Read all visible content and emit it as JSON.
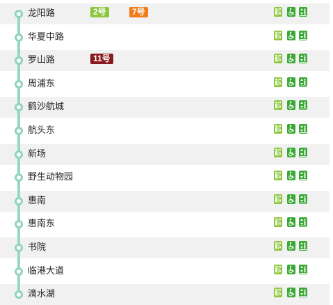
{
  "colors": {
    "route_line": "#94d7c4",
    "line_2": "#8cc63f",
    "line_7": "#ef7d1a",
    "line_11": "#8b1a1f",
    "facility_toilet": "#8cc63f",
    "facility_accessible": "#3aa935",
    "facility_elevator": "#3aa935"
  },
  "icons": [
    "toilet-icon",
    "accessibility-icon",
    "elevator-icon"
  ],
  "stations": [
    {
      "name": "龙阳路",
      "transfers": [
        {
          "label": "2号",
          "color": "#8cc63f"
        },
        {
          "label": "7号",
          "color": "#ef7d1a"
        }
      ]
    },
    {
      "name": "华夏中路",
      "transfers": []
    },
    {
      "name": "罗山路",
      "transfers": [
        {
          "label": "11号",
          "color": "#8b1a1f"
        }
      ]
    },
    {
      "name": "周浦东",
      "transfers": []
    },
    {
      "name": "鹤沙航城",
      "transfers": []
    },
    {
      "name": "航头东",
      "transfers": []
    },
    {
      "name": "新场",
      "transfers": []
    },
    {
      "name": "野生动物园",
      "transfers": []
    },
    {
      "name": "惠南",
      "transfers": []
    },
    {
      "name": "惠南东",
      "transfers": []
    },
    {
      "name": "书院",
      "transfers": []
    },
    {
      "name": "临港大道",
      "transfers": []
    },
    {
      "name": "滴水湖",
      "transfers": []
    }
  ]
}
